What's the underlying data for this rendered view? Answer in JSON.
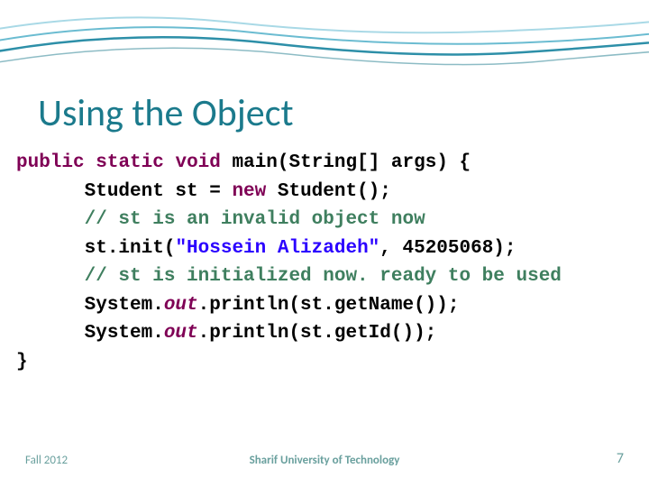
{
  "slide": {
    "title": "Using the Object",
    "footer_left": "Fall 2012",
    "footer_center": "Sharif University of Technology",
    "page_number": "7"
  },
  "code": {
    "l1a": "public",
    "l1b": "static",
    "l1c": "void",
    "l1d": " main(String[] args) {",
    "l2a": "      Student st = ",
    "l2b": "new",
    "l2c": " Student();",
    "l3": "      // st is an invalid object now",
    "l4a": "      st.init(",
    "l4b": "\"Hossein Alizadeh\"",
    "l4c": ", 45205068);",
    "l5": "      // st is initialized now. ready to be used",
    "l6a": "      System.",
    "l6b": "out",
    "l6c": ".println(st.getName());",
    "l7a": "      System.",
    "l7b": "out",
    "l7c": ".println(st.getId());",
    "l8": "}"
  }
}
